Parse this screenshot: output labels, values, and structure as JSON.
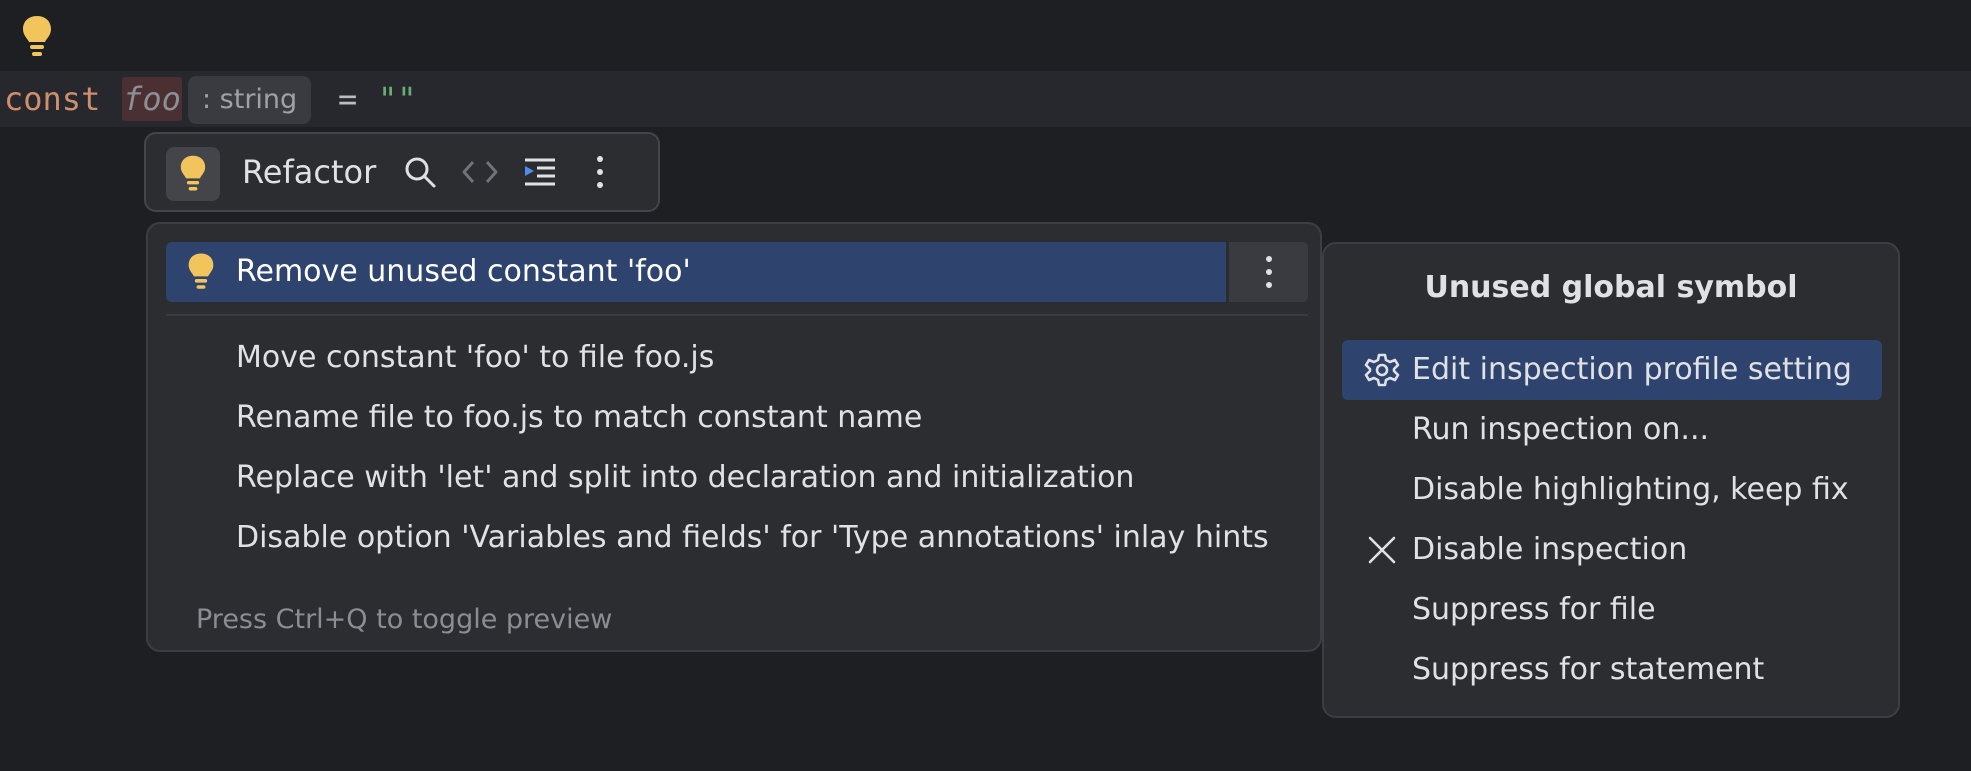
{
  "editor": {
    "keyword": "const",
    "identifier": "foo",
    "type_hint": ": string",
    "operator": "=",
    "string_literal": "\"\""
  },
  "toolbar": {
    "label": "Refactor",
    "icons": [
      "bulb-icon",
      "search-icon",
      "code-brackets-icon",
      "indent-icon",
      "more-vertical-icon"
    ]
  },
  "intentions": {
    "selected": "Remove unused constant 'foo'",
    "items": [
      "Move constant 'foo' to file foo.js",
      "Rename file to foo.js to match constant name",
      "Replace with 'let' and split into declaration and initialization",
      "Disable option 'Variables and fields' for 'Type annotations' inlay hints"
    ],
    "footer": "Press Ctrl+Q to toggle preview"
  },
  "inspection": {
    "title": "Unused global symbol",
    "items": [
      "Edit inspection profile setting",
      "Run inspection on...",
      "Disable highlighting, keep fix",
      "Disable inspection",
      "Suppress for file",
      "Suppress for statement"
    ]
  },
  "colors": {
    "background": "#1e1f22",
    "popup": "#2b2d30",
    "selection": "#2e436e",
    "bulb": "#f2c55c",
    "keyword": "#cf8e6d",
    "string": "#6aab73"
  }
}
